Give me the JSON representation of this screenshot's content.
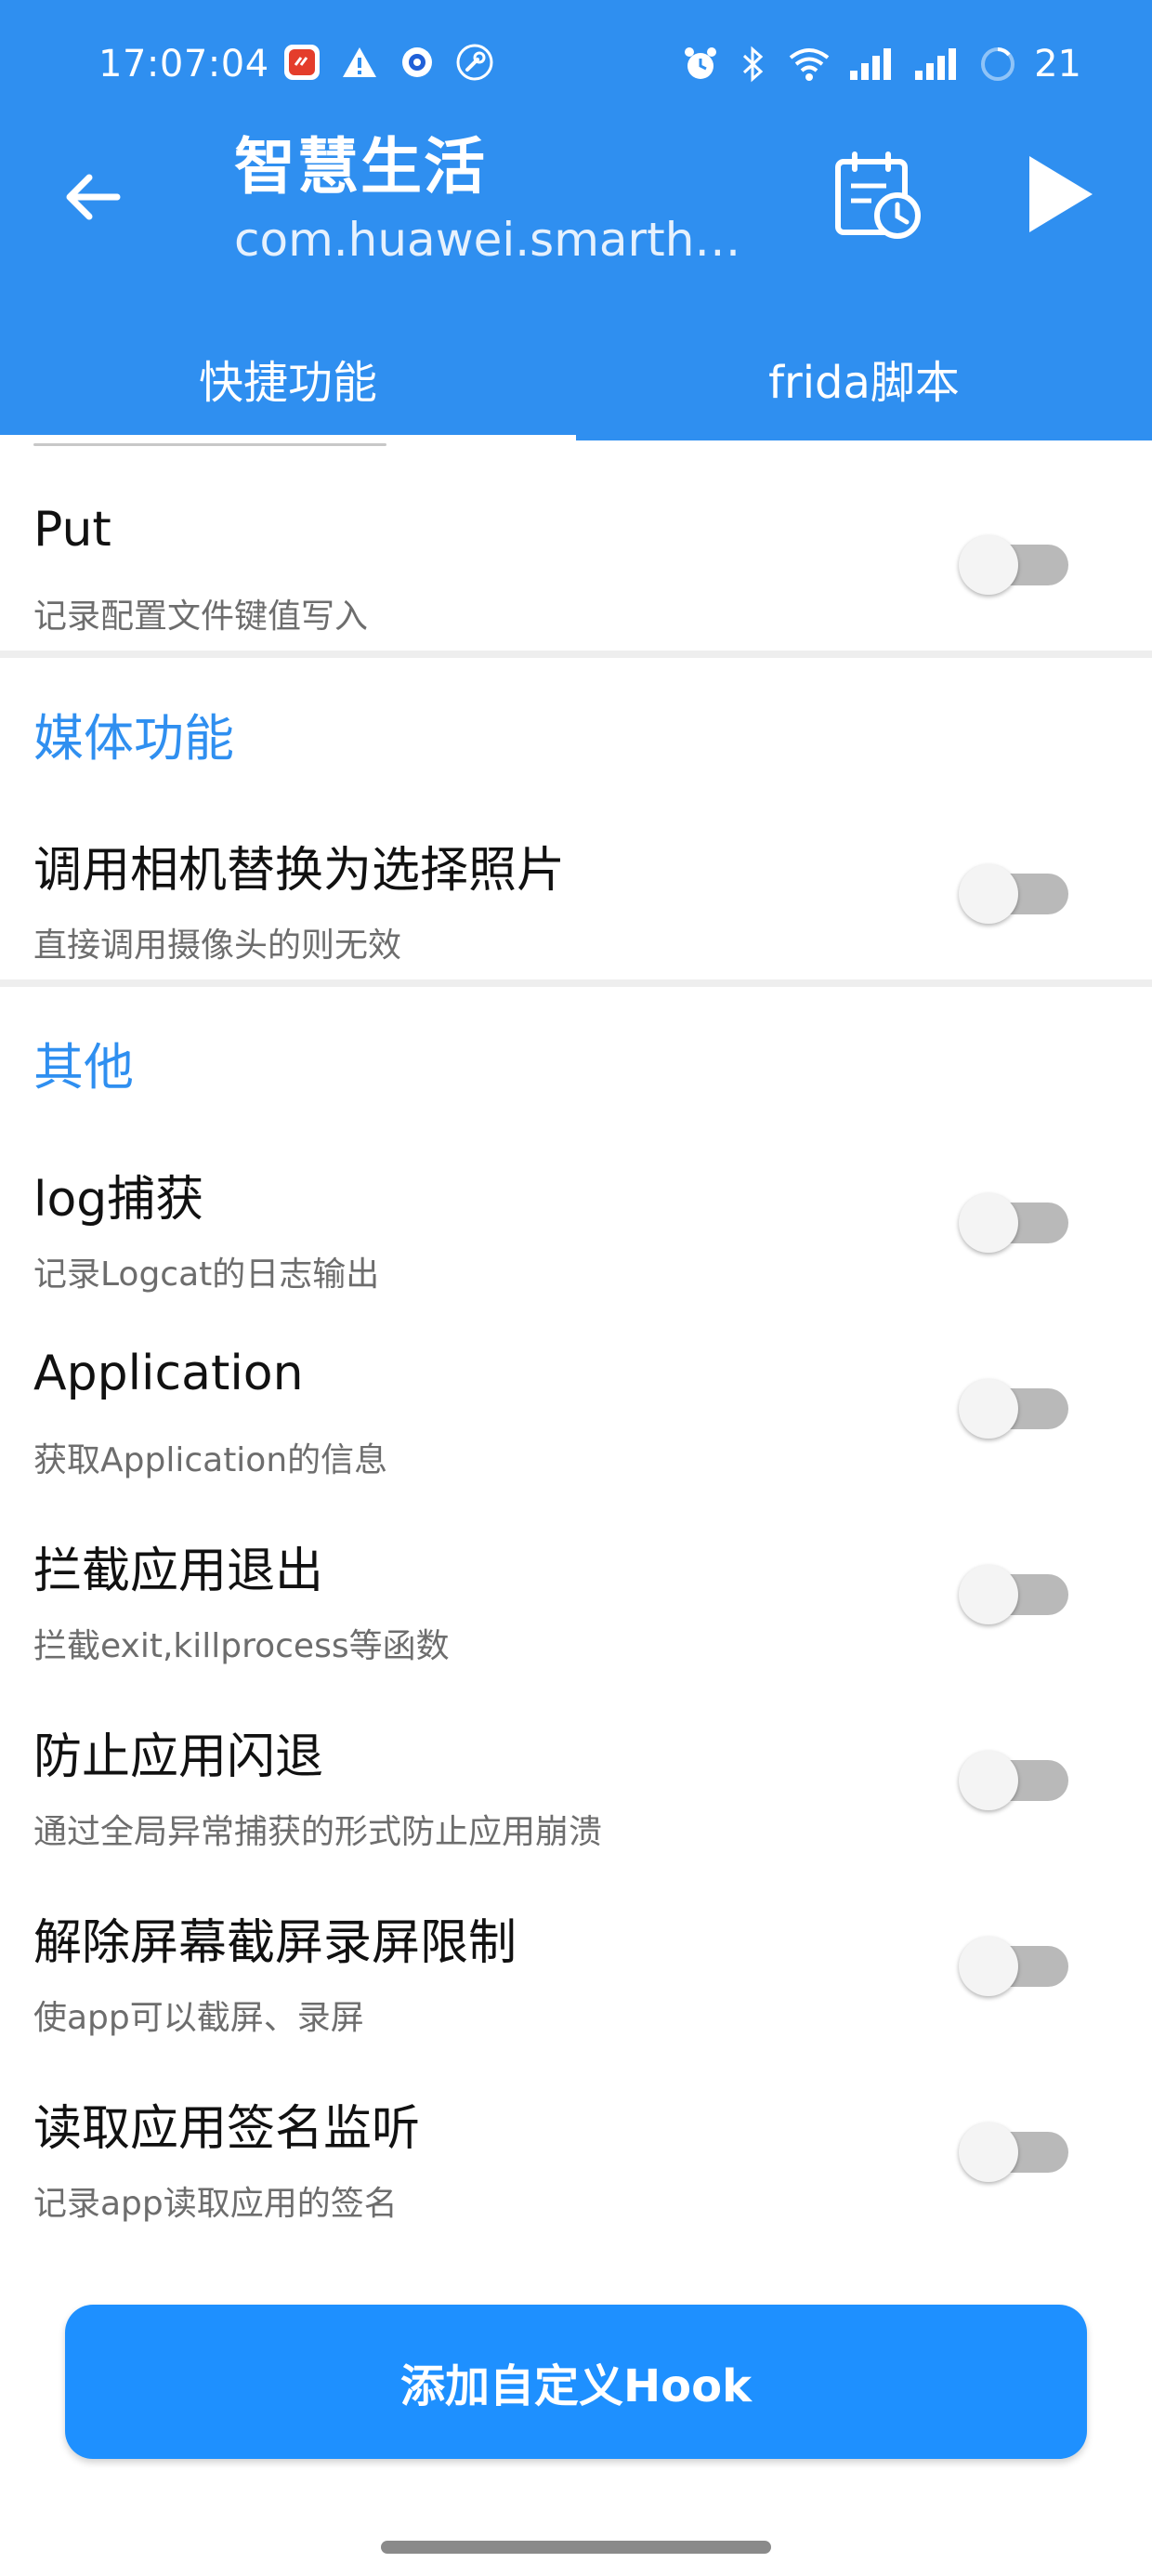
{
  "status_bar": {
    "time": "17:07:04",
    "battery": "21"
  },
  "app_bar": {
    "title": "智慧生活",
    "subtitle": "com.huawei.smartho..."
  },
  "tabs": [
    {
      "label": "快捷功能",
      "active": true
    },
    {
      "label": "frida脚本",
      "active": false
    }
  ],
  "sections": {
    "media": "媒体功能",
    "other": "其他"
  },
  "items": [
    {
      "title": "Put",
      "desc": "记录配置文件键值写入",
      "enabled": false
    },
    {
      "title": "调用相机替换为选择照片",
      "desc": "直接调用摄像头的则无效",
      "enabled": false
    },
    {
      "title": "log捕获",
      "desc": "记录Logcat的日志输出",
      "enabled": false
    },
    {
      "title": "Application",
      "desc": "获取Application的信息",
      "enabled": false
    },
    {
      "title": "拦截应用退出",
      "desc": "拦截exit,killprocess等函数",
      "enabled": false
    },
    {
      "title": "防止应用闪退",
      "desc": "通过全局异常捕获的形式防止应用崩溃",
      "enabled": false
    },
    {
      "title": "解除屏幕截屏录屏限制",
      "desc": "使app可以截屏、录屏",
      "enabled": false
    },
    {
      "title": "读取应用签名监听",
      "desc": "记录app读取应用的签名",
      "enabled": false
    }
  ],
  "fab": {
    "label": "添加自定义Hook"
  },
  "colors": {
    "primary": "#2f8ff0",
    "fab": "#1e90ff",
    "section_text": "#2f8ff0"
  }
}
